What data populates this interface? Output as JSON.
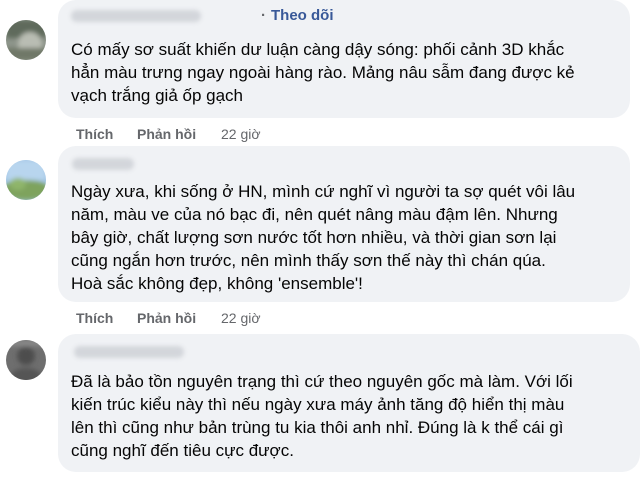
{
  "comments": [
    {
      "follow_label": "Theo dõi",
      "text": "Có mấy sơ suất khiến dư luận càng dậy sóng: phối cảnh 3D khắc\nhẳn màu trưng ngay ngoài hàng rào. Mảng nâu sẫm đang được kẻ\nvạch trắng giả ốp gạch",
      "actions": {
        "like": "Thích",
        "reply": "Phản hồi",
        "time": "22 giờ"
      }
    },
    {
      "text": "Ngày xưa, khi sống ở HN, mình cứ nghĩ vì người ta sợ quét vôi lâu\nnăm, màu ve của nó bạc đi, nên quét nâng màu đậm lên. Nhưng\nbây giờ, chất lượng sơn nước tốt hơn nhiều, và thời gian sơn lại\ncũng ngắn hơn trước, nên mình thấy sơn thế này thì chán qúa.\nHoà sắc không đẹp, không 'ensemble'!",
      "actions": {
        "like": "Thích",
        "reply": "Phản hồi",
        "time": "22 giờ"
      }
    },
    {
      "text": "Đã là bảo tồn nguyên trạng thì cứ theo nguyên gốc mà làm. Với lối\nkiến trúc kiểu này thì nếu ngày xưa máy ảnh tăng độ hiển thị màu\nlên thì cũng như bản trùng tu kia thôi anh nhỉ. Đúng là k thể cái gì\ncũng nghĩ đến tiêu cực được.",
      "actions": {}
    }
  ],
  "colors": {
    "bubble_bg": "#f0f2f5",
    "link_blue": "#385898",
    "meta_gray": "#65676b",
    "text": "#050505"
  }
}
